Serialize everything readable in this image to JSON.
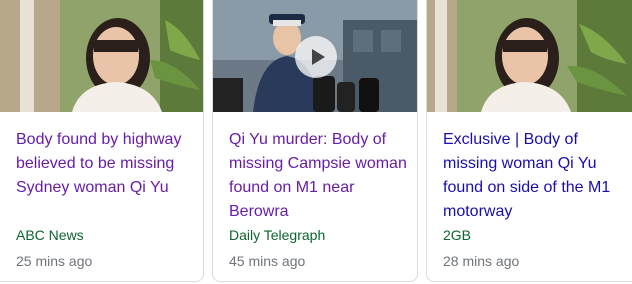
{
  "cards": [
    {
      "headline": "Body found by highway believed to be missing Sydney woman Qi Yu",
      "source": "ABC News",
      "time": "25 mins ago",
      "image_icon": "portrait-photo",
      "has_video": false
    },
    {
      "headline": "Qi Yu murder: Body of missing Campsie woman found on M1 near Berowra",
      "source": "Daily Telegraph",
      "time": "45 mins ago",
      "image_icon": "press-conference-photo",
      "has_video": true
    },
    {
      "headline": "Exclusive | Body of missing woman Qi Yu found on side of the M1 motorway",
      "source": "2GB",
      "time": "28 mins ago",
      "image_icon": "portrait-photo",
      "has_video": false
    }
  ],
  "colors": {
    "visited_link": "#681da8",
    "link": "#1a0dab",
    "source": "#0d652d",
    "meta": "#70757a",
    "border": "#dadce0"
  }
}
